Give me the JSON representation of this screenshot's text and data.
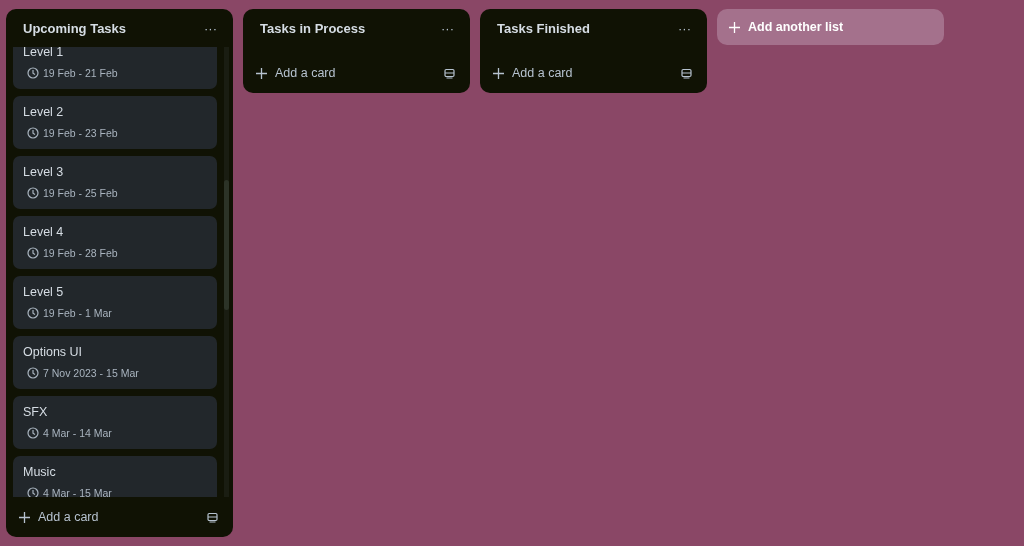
{
  "lists": [
    {
      "title": "Upcoming Tasks",
      "menu": "···",
      "add_label": "Add a card",
      "cards": [
        {
          "title": "Level 1",
          "dates": "19 Feb - 21 Feb"
        },
        {
          "title": "Level 2",
          "dates": "19 Feb - 23 Feb"
        },
        {
          "title": "Level 3",
          "dates": "19 Feb - 25 Feb"
        },
        {
          "title": "Level 4",
          "dates": "19 Feb - 28 Feb"
        },
        {
          "title": "Level 5",
          "dates": "19 Feb - 1 Mar"
        },
        {
          "title": "Options UI",
          "dates": "7 Nov 2023 - 15 Mar"
        },
        {
          "title": "SFX",
          "dates": "4 Mar - 14 Mar"
        },
        {
          "title": "Music",
          "dates": "4 Mar - 15 Mar"
        }
      ]
    },
    {
      "title": "Tasks in Process",
      "menu": "···",
      "add_label": "Add a card"
    },
    {
      "title": "Tasks Finished",
      "menu": "···",
      "add_label": "Add a card"
    }
  ],
  "add_list_label": "Add another list"
}
